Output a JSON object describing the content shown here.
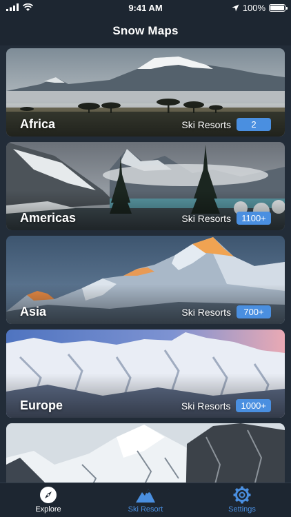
{
  "status": {
    "time": "9:41 AM",
    "battery": "100%"
  },
  "nav": {
    "title": "Snow Maps"
  },
  "cards": [
    {
      "name": "Africa",
      "resorts_label": "Ski Resorts",
      "count": "2"
    },
    {
      "name": "Americas",
      "resorts_label": "Ski Resorts",
      "count": "1100+"
    },
    {
      "name": "Asia",
      "resorts_label": "Ski Resorts",
      "count": "700+"
    },
    {
      "name": "Europe",
      "resorts_label": "Ski Resorts",
      "count": "1000+"
    }
  ],
  "tabs": [
    {
      "label": "Explore",
      "icon": "compass-icon",
      "active": true
    },
    {
      "label": "Ski Resort",
      "icon": "mountain-icon",
      "active": false
    },
    {
      "label": "Settings",
      "icon": "gear-icon",
      "active": false
    }
  ],
  "colors": {
    "background": "#1d2631",
    "accent": "#4a8fe0"
  }
}
